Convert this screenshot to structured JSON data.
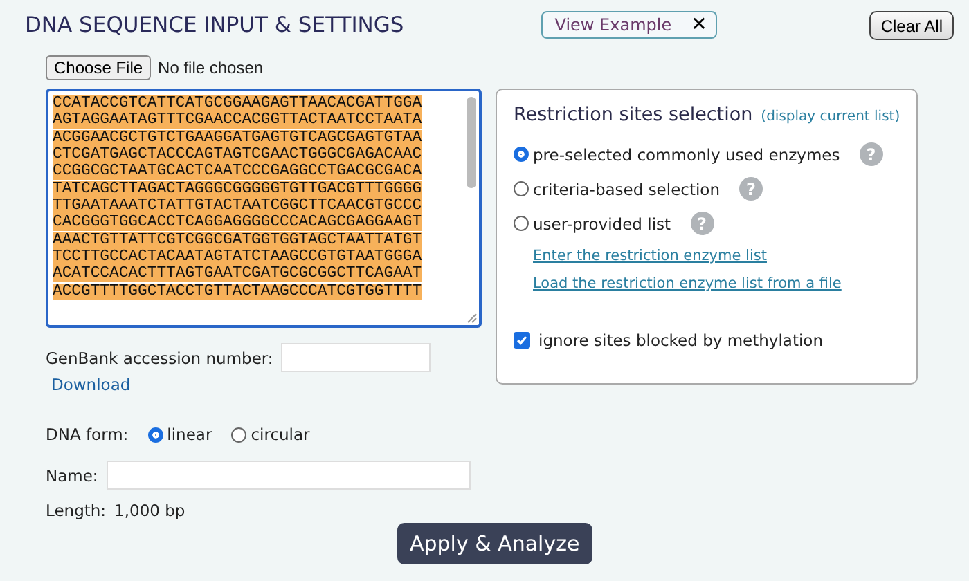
{
  "header": {
    "title": "DNA SEQUENCE INPUT & SETTINGS",
    "example_button": {
      "label": "View Example",
      "close": "✕"
    },
    "clear_button": "Clear All"
  },
  "file_input": {
    "button": "Choose File",
    "status": "No file chosen"
  },
  "sequence": {
    "selected": true,
    "lines": [
      "CCATACCGTCATTCATGCGGAAGAGTTAACACGATTGGA",
      "AGTAGGAATAGTTTCGAACCACGGTTACTAATCCTAATA",
      "ACGGAACGCTGTCTGAAGGATGAGTGTCAGCGAGTGTAA",
      "CTCGATGAGCTACCCAGTAGTCGAACTGGGCGAGACAAC",
      "CCGGCGCTAATGCACTCAATCCCGAGGCCTGACGCGACA",
      "TATCAGCTTAGACTAGGGCGGGGGTGTTGACGTTTGGGG",
      "TTGAATAAATCTATTGTACTAATCGGCTTCAACGTGCCC",
      "CACGGGTGGCACCTCAGGAGGGGCCCACAGCGAGGAAGT",
      "AAACTGTTATTCGTCGGCGATGGTGGTAGCTAATTATGT",
      "TCCTTGCCACTACAATAGTATCTAAGCCGTGTAATGGGA",
      "ACATCCACACTTTAGTGAATCGATGCGCGGCTTCAGAAT",
      "ACCGTTTTGGCTACCTGTTACTAAGCCCATCGTGGTTTT"
    ]
  },
  "genbank": {
    "label": "GenBank accession number:",
    "link": "Download"
  },
  "dna_form": {
    "label": "DNA form:",
    "options": [
      {
        "label": "linear",
        "selected": true
      },
      {
        "label": "circular",
        "selected": false
      }
    ]
  },
  "name_field": {
    "label": "Name:"
  },
  "length": {
    "label": "Length:",
    "value": "1,000 bp"
  },
  "apply_button": "Apply & Analyze",
  "restriction_panel": {
    "title": "Restriction sites selection",
    "title_link": "(display current list)",
    "options": [
      {
        "label": "pre-selected commonly used enzymes",
        "selected": true,
        "help": "?"
      },
      {
        "label": "criteria-based selection",
        "selected": false,
        "help": "?"
      },
      {
        "label": "user-provided list",
        "selected": false,
        "help": "?"
      }
    ],
    "links": [
      "Enter the restriction enzyme list",
      "Load the restriction enzyme list from a file"
    ],
    "methylation": {
      "label": "ignore sites blocked by methylation",
      "checked": true
    }
  }
}
